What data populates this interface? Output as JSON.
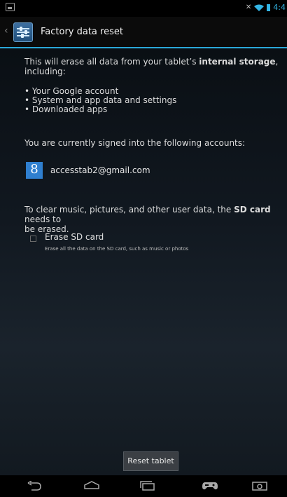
{
  "status_bar": {
    "time": "4:4"
  },
  "action_bar": {
    "title": "Factory data reset"
  },
  "content": {
    "intro_part1": "This will erase all data from your tablet’s ",
    "intro_bold": "internal storage",
    "intro_part2": ",",
    "intro_line2": "including:",
    "items": [
      "Your Google account",
      "System and app data and settings",
      "Downloaded apps"
    ],
    "signed_in_text": "You are currently signed into the following accounts:",
    "account_email": "accesstab2@gmail.com",
    "account_icon_letter": "8",
    "sd_text_part1": "To clear music, pictures, and other user data, the ",
    "sd_bold": "SD card",
    "sd_text_part2": " needs to",
    "sd_text_line2": "be erased.",
    "erase_sd_title": "Erase SD card",
    "erase_sd_subtitle": "Erase all the data on the SD card, such as music or photos"
  },
  "buttons": {
    "reset": "Reset tablet"
  }
}
